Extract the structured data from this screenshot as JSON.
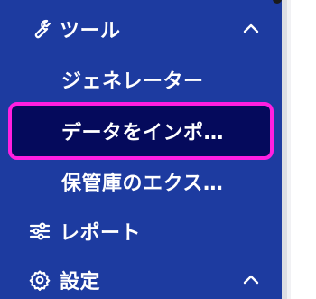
{
  "sidebar": {
    "tools": {
      "label": "ツール",
      "icon": "wrench-icon",
      "expanded": true,
      "children": [
        {
          "label": "ジェネレーター",
          "selected": false
        },
        {
          "label": "データをインポ…",
          "selected": true
        },
        {
          "label": "保管庫のエクス…",
          "selected": false
        }
      ]
    },
    "reports": {
      "label": "レポート",
      "icon": "sliders-icon"
    },
    "settings": {
      "label": "設定",
      "icon": "gear-icon",
      "expanded": true
    }
  },
  "colors": {
    "sidebar_bg": "#1d3ba0",
    "selected_bg": "#050a5c",
    "focus_ring": "#ff1fe0",
    "text": "#ffffff"
  }
}
